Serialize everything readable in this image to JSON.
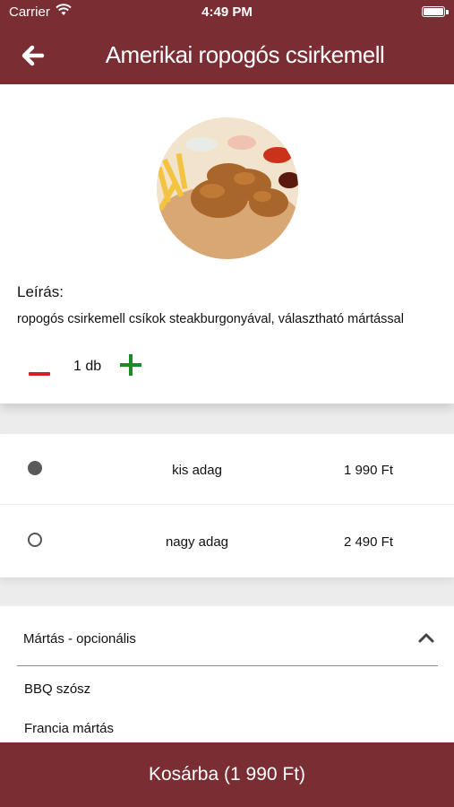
{
  "status": {
    "carrier": "Carrier",
    "time": "4:49 PM"
  },
  "nav": {
    "title": "Amerikai ropogós csirkemell"
  },
  "product": {
    "description_label": "Leírás:",
    "description": "ropogós csirkemell csíkok steakburgonyával, választható mártással",
    "quantity": "1 db"
  },
  "sizes": [
    {
      "name": "kis adag",
      "price": "1 990 Ft",
      "selected": true
    },
    {
      "name": "nagy adag",
      "price": "2 490 Ft",
      "selected": false
    }
  ],
  "sauce": {
    "title": "Mártás - opcionális",
    "items": [
      "BBQ szósz",
      "Francia mártás"
    ]
  },
  "cart": {
    "label": "Kosárba (1 990 Ft)"
  },
  "colors": {
    "brand": "#7a2d33",
    "minus": "#d81e1e",
    "plus": "#1d8a2a"
  }
}
